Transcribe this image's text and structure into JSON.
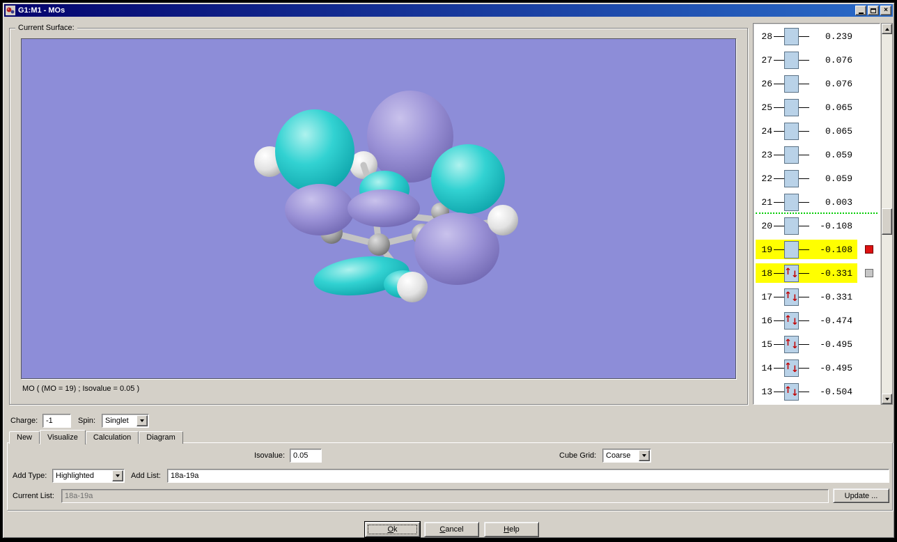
{
  "window": {
    "title": "G1:M1 - MOs",
    "close_glyph": "×"
  },
  "surface": {
    "group_label": "Current Surface:",
    "caption": "MO ( (MO = 19) ; Isovalue = 0.05 )"
  },
  "colors": {
    "viewport_background": "#8d8dd8",
    "positive_lobe": "#9a91d6",
    "negative_lobe": "#1fcccc",
    "highlight_row": "#ffff00",
    "homo_lumo_divider": "#00cc00",
    "selected_marker": "#dd1111"
  },
  "mo_diagram": {
    "divider_after_number": "21",
    "levels": [
      {
        "number": "28",
        "energy": "0.239",
        "occupied": false,
        "highlighted": false,
        "marker": ""
      },
      {
        "number": "27",
        "energy": "0.076",
        "occupied": false,
        "highlighted": false,
        "marker": ""
      },
      {
        "number": "26",
        "energy": "0.076",
        "occupied": false,
        "highlighted": false,
        "marker": ""
      },
      {
        "number": "25",
        "energy": "0.065",
        "occupied": false,
        "highlighted": false,
        "marker": ""
      },
      {
        "number": "24",
        "energy": "0.065",
        "occupied": false,
        "highlighted": false,
        "marker": ""
      },
      {
        "number": "23",
        "energy": "0.059",
        "occupied": false,
        "highlighted": false,
        "marker": ""
      },
      {
        "number": "22",
        "energy": "0.059",
        "occupied": false,
        "highlighted": false,
        "marker": ""
      },
      {
        "number": "21",
        "energy": "0.003",
        "occupied": false,
        "highlighted": false,
        "marker": ""
      },
      {
        "number": "20",
        "energy": "-0.108",
        "occupied": false,
        "highlighted": false,
        "marker": ""
      },
      {
        "number": "19",
        "energy": "-0.108",
        "occupied": false,
        "highlighted": true,
        "marker": "red"
      },
      {
        "number": "18",
        "energy": "-0.331",
        "occupied": true,
        "highlighted": true,
        "marker": "gray"
      },
      {
        "number": "17",
        "energy": "-0.331",
        "occupied": true,
        "highlighted": false,
        "marker": ""
      },
      {
        "number": "16",
        "energy": "-0.474",
        "occupied": true,
        "highlighted": false,
        "marker": ""
      },
      {
        "number": "15",
        "energy": "-0.495",
        "occupied": true,
        "highlighted": false,
        "marker": ""
      },
      {
        "number": "14",
        "energy": "-0.495",
        "occupied": true,
        "highlighted": false,
        "marker": ""
      },
      {
        "number": "13",
        "energy": "-0.504",
        "occupied": true,
        "highlighted": false,
        "marker": ""
      }
    ]
  },
  "charge_spin": {
    "charge_label": "Charge:",
    "charge_value": "-1",
    "spin_label": "Spin:",
    "spin_value": "Singlet"
  },
  "tabs": {
    "items": [
      {
        "label": "New"
      },
      {
        "label": "Visualize"
      },
      {
        "label": "Calculation"
      },
      {
        "label": "Diagram"
      }
    ]
  },
  "visualize": {
    "isovalue_label": "Isovalue:",
    "isovalue_value": "0.05",
    "cube_grid_label": "Cube Grid:",
    "cube_grid_value": "Coarse",
    "add_type_label": "Add Type:",
    "add_type_value": "Highlighted",
    "add_list_label": "Add List:",
    "add_list_value": "18a-19a",
    "current_list_label": "Current List:",
    "current_list_value": "18a-19a",
    "update_button": "Update ..."
  },
  "footer": {
    "ok": "Ok",
    "cancel": "Cancel",
    "help": "Help"
  }
}
